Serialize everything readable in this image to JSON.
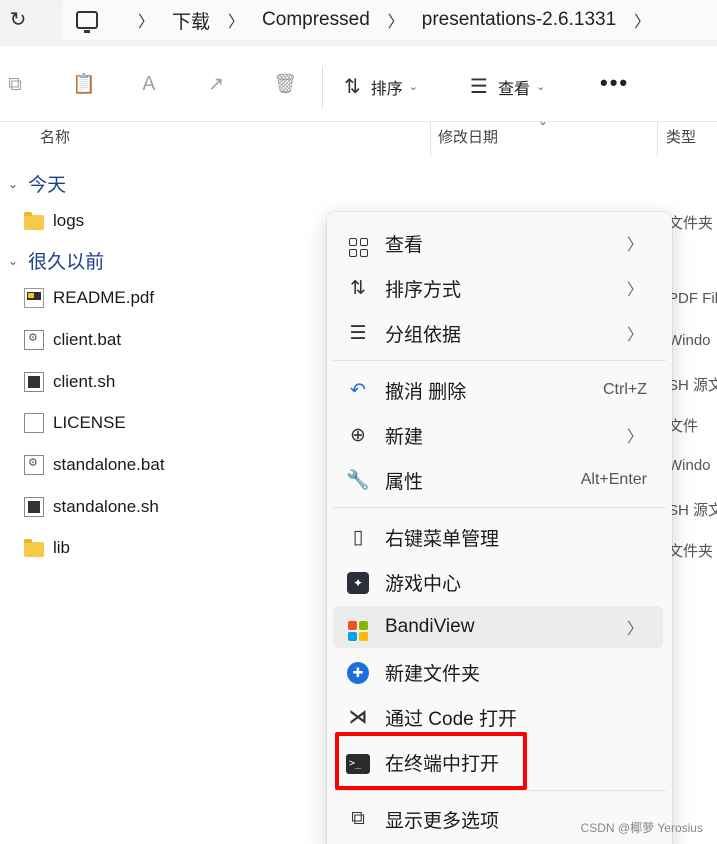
{
  "address_bar": {
    "refresh_icon": "refresh-icon",
    "crumbs": [
      "下载",
      "Compressed",
      "presentations-2.6.1331"
    ]
  },
  "toolbar": {
    "sort_label": "排序",
    "view_label": "查看",
    "more_label": "•••"
  },
  "columns": {
    "name": "名称",
    "modified": "修改日期",
    "type": "类型"
  },
  "groups": [
    {
      "label": "今天",
      "items": [
        {
          "name": "logs",
          "icon": "folder-icon",
          "type": "文件夹"
        }
      ]
    },
    {
      "label": "很久以前",
      "items": [
        {
          "name": "README.pdf",
          "icon": "pdf-icon",
          "type": "PDF Fil"
        },
        {
          "name": "client.bat",
          "icon": "bat-icon",
          "type": "Windo"
        },
        {
          "name": "client.sh",
          "icon": "sh-icon",
          "type": "SH 源文"
        },
        {
          "name": "LICENSE",
          "icon": "file-icon",
          "type": "文件"
        },
        {
          "name": "standalone.bat",
          "icon": "bat-icon",
          "type": "Windo"
        },
        {
          "name": "standalone.sh",
          "icon": "sh-icon",
          "type": "SH 源文"
        },
        {
          "name": "lib",
          "icon": "folder-icon",
          "type": "文件夹"
        }
      ]
    }
  ],
  "context_menu": {
    "items": [
      {
        "label": "查看",
        "icon": "grid-icon",
        "submenu": true
      },
      {
        "label": "排序方式",
        "icon": "sort-icon",
        "submenu": true
      },
      {
        "label": "分组依据",
        "icon": "group-icon",
        "submenu": true
      },
      {
        "label": "撤消 删除",
        "icon": "undo-icon",
        "shortcut": "Ctrl+Z"
      },
      {
        "label": "新建",
        "icon": "plus-circle-icon",
        "submenu": true
      },
      {
        "label": "属性",
        "icon": "wrench-icon",
        "shortcut": "Alt+Enter"
      },
      {
        "label": "右键菜单管理",
        "icon": "mouse-icon"
      },
      {
        "label": "游戏中心",
        "icon": "game-center-icon"
      },
      {
        "label": "BandiView",
        "icon": "bandiview-icon",
        "submenu": true
      },
      {
        "label": "新建文件夹",
        "icon": "new-folder-icon"
      },
      {
        "label": "通过 Code 打开",
        "icon": "vscode-icon"
      },
      {
        "label": "在终端中打开",
        "icon": "terminal-icon"
      },
      {
        "label": "显示更多选项",
        "icon": "more-options-icon"
      }
    ],
    "highlight_color": "#ff0000"
  },
  "watermark": "CSDN @椰萝 Yerosius"
}
